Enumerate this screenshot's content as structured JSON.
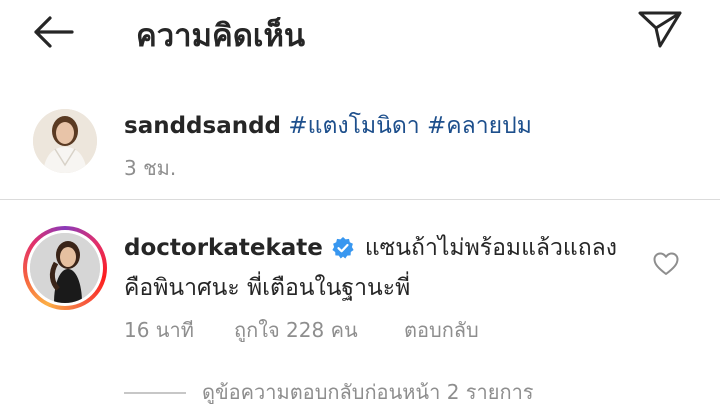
{
  "header": {
    "title": "ความคิดเห็น",
    "back_icon": "arrow-left-icon",
    "send_icon": "paper-plane-icon"
  },
  "caption": {
    "username": "sanddsandd",
    "text": "#แตงโมนิดา #คลายปม",
    "time": "3 ชม."
  },
  "comment": {
    "username": "doctorkatekate",
    "verified": true,
    "text_line1": "แซนถ้าไม่พร้อมแล้วแถลง",
    "text_line2": "คือพินาศนะ พี่เตือนในฐานะพี่",
    "time": "16 นาที",
    "likes": "ถูกใจ 228 คน",
    "reply_label": "ตอบกลับ",
    "like_icon": "heart-outline-icon"
  },
  "replies": {
    "view_label": "ดูข้อความตอบกลับก่อนหน้า 2 รายการ"
  },
  "colors": {
    "text": "#262626",
    "secondary": "#8e8e8e",
    "hashtag": "#1d4f8c",
    "verified": "#3897f0",
    "divider": "#dbdbdb"
  }
}
